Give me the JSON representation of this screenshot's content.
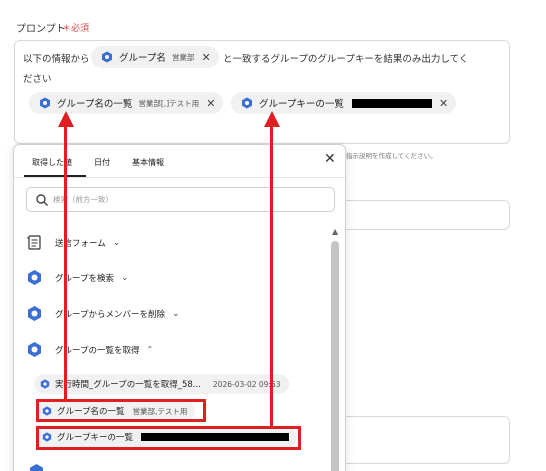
{
  "field": {
    "label": "プロンプト",
    "required": "＊必須"
  },
  "prompt": {
    "text_1": "以下の情報から",
    "text_2": "と一致するグループのグループキーを結果のみ出力してく",
    "text_3": "ださい",
    "chip_group_name": {
      "name": "グループ名",
      "sub": "営業部"
    },
    "chip_group_list": {
      "name": "グループ名の一覧",
      "sub": "営業部[,]テスト用"
    },
    "chip_group_key": {
      "name": "グループキーの一覧"
    }
  },
  "hint": "指示説明を作成してください。",
  "panel": {
    "tabs": [
      "取得した値",
      "日付",
      "基本情報"
    ],
    "search_placeholder": "検索（前方一致）",
    "sections": [
      {
        "label": "送信フォーム",
        "icon": "form-icon",
        "expanded": false
      },
      {
        "label": "グループを検索",
        "icon": "google-workspace-icon",
        "expanded": false
      },
      {
        "label": "グループからメンバーを削除",
        "icon": "google-workspace-icon",
        "expanded": false
      },
      {
        "label": "グループの一覧を取得",
        "icon": "google-workspace-icon",
        "expanded": true
      }
    ],
    "run_history": {
      "label": "実行時間_グループの一覧を取得_58...",
      "time": "2026-03-02 09:53"
    },
    "outputs": [
      {
        "name": "グループ名の一覧",
        "sub": "営業部,テスト用"
      },
      {
        "name": "グループキーの一覧"
      }
    ]
  },
  "colors": {
    "accent_red": "#e02020",
    "google_blue": "#3b6fd6",
    "required_red": "#e5484d"
  }
}
